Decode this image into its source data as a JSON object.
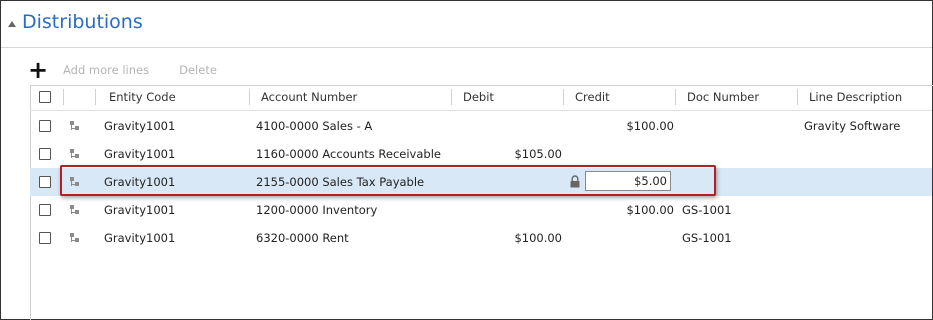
{
  "section": {
    "title": "Distributions"
  },
  "toolbar": {
    "add_label": "+",
    "add_more_lines": "Add more lines",
    "delete": "Delete"
  },
  "columns": [
    "Entity Code",
    "Account Number",
    "Debit",
    "Credit",
    "Doc Number",
    "Line Description"
  ],
  "rows": [
    {
      "entity": "Gravity1001",
      "account": "4100-0000 Sales - A",
      "debit": "",
      "credit": "$100.00",
      "doc": "",
      "description": "Gravity Software"
    },
    {
      "entity": "Gravity1001",
      "account": "1160-0000 Accounts Receivable",
      "debit": "$105.00",
      "credit": "",
      "doc": "",
      "description": ""
    },
    {
      "entity": "Gravity1001",
      "account": "2155-0000 Sales Tax Payable",
      "debit": "",
      "credit": "$5.00",
      "doc": "",
      "description": ""
    },
    {
      "entity": "Gravity1001",
      "account": "1200-0000 Inventory",
      "debit": "",
      "credit": "$100.00",
      "doc": "GS-1001",
      "description": ""
    },
    {
      "entity": "Gravity1001",
      "account": "6320-0000 Rent",
      "debit": "$100.00",
      "credit": "",
      "doc": "GS-1001",
      "description": ""
    }
  ],
  "colors": {
    "title": "#2a6cc4",
    "selected_row": "#d9e8f6",
    "highlight_border": "#b21f24"
  },
  "icons": {
    "collapse": "triangle-up-icon",
    "add": "plus-icon",
    "row": "hierarchy-icon",
    "lock": "lock-icon"
  }
}
